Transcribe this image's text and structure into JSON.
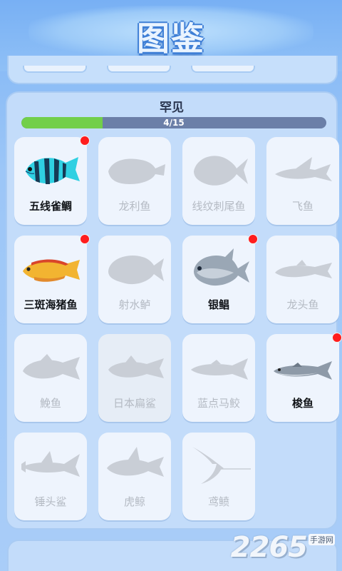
{
  "header": {
    "title": "图鉴"
  },
  "section": {
    "title": "罕见",
    "progress_text": "4/15",
    "progress_value": 0.267
  },
  "colors": {
    "progress_fill": "#72cf4a",
    "progress_track": "#6b7fa8",
    "new_dot": "#ff1d1d",
    "silhouette": "#c9ced6"
  },
  "cards": [
    {
      "label": "五线雀鲷",
      "found": true,
      "new": true,
      "icon": "striped-damselfish-icon"
    },
    {
      "label": "龙利鱼",
      "found": false,
      "new": false,
      "icon": "sole-fish-silhouette-icon"
    },
    {
      "label": "线纹刺尾鱼",
      "found": false,
      "new": false,
      "icon": "surgeonfish-silhouette-icon"
    },
    {
      "label": "飞鱼",
      "found": false,
      "new": false,
      "icon": "flying-fish-silhouette-icon"
    },
    {
      "label": "三斑海猪鱼",
      "found": true,
      "new": true,
      "icon": "wrasse-icon"
    },
    {
      "label": "射水鲈",
      "found": false,
      "new": false,
      "icon": "archerfish-silhouette-icon"
    },
    {
      "label": "银鲳",
      "found": true,
      "new": true,
      "icon": "silver-pomfret-icon"
    },
    {
      "label": "龙头鱼",
      "found": false,
      "new": false,
      "icon": "bombay-duck-silhouette-icon"
    },
    {
      "label": "鮸鱼",
      "found": false,
      "new": false,
      "icon": "croaker-silhouette-icon"
    },
    {
      "label": "日本扁鲨",
      "found": false,
      "new": false,
      "icon": "angel-shark-silhouette-icon"
    },
    {
      "label": "蓝点马鲛",
      "found": false,
      "new": false,
      "icon": "mackerel-silhouette-icon"
    },
    {
      "label": "梭鱼",
      "found": true,
      "new": true,
      "icon": "barracuda-icon"
    },
    {
      "label": "锤头鲨",
      "found": false,
      "new": false,
      "icon": "hammerhead-silhouette-icon"
    },
    {
      "label": "虎鲸",
      "found": false,
      "new": false,
      "icon": "orca-silhouette-icon"
    },
    {
      "label": "鸢鲼",
      "found": false,
      "new": false,
      "icon": "eagle-ray-silhouette-icon"
    }
  ],
  "watermark": {
    "number": "2265",
    "suffix": "手游网"
  }
}
